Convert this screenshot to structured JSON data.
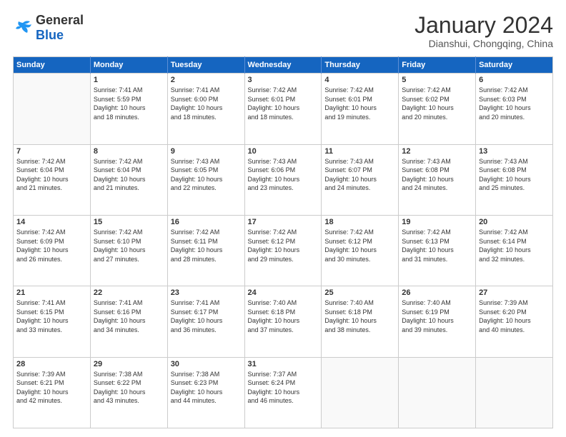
{
  "header": {
    "logo_line1": "General",
    "logo_line2": "Blue",
    "title": "January 2024",
    "subtitle": "Dianshui, Chongqing, China"
  },
  "calendar": {
    "days_of_week": [
      "Sunday",
      "Monday",
      "Tuesday",
      "Wednesday",
      "Thursday",
      "Friday",
      "Saturday"
    ],
    "weeks": [
      [
        {
          "day": "",
          "info": ""
        },
        {
          "day": "1",
          "info": "Sunrise: 7:41 AM\nSunset: 5:59 PM\nDaylight: 10 hours\nand 18 minutes."
        },
        {
          "day": "2",
          "info": "Sunrise: 7:41 AM\nSunset: 6:00 PM\nDaylight: 10 hours\nand 18 minutes."
        },
        {
          "day": "3",
          "info": "Sunrise: 7:42 AM\nSunset: 6:01 PM\nDaylight: 10 hours\nand 18 minutes."
        },
        {
          "day": "4",
          "info": "Sunrise: 7:42 AM\nSunset: 6:01 PM\nDaylight: 10 hours\nand 19 minutes."
        },
        {
          "day": "5",
          "info": "Sunrise: 7:42 AM\nSunset: 6:02 PM\nDaylight: 10 hours\nand 20 minutes."
        },
        {
          "day": "6",
          "info": "Sunrise: 7:42 AM\nSunset: 6:03 PM\nDaylight: 10 hours\nand 20 minutes."
        }
      ],
      [
        {
          "day": "7",
          "info": "Sunrise: 7:42 AM\nSunset: 6:04 PM\nDaylight: 10 hours\nand 21 minutes."
        },
        {
          "day": "8",
          "info": "Sunrise: 7:42 AM\nSunset: 6:04 PM\nDaylight: 10 hours\nand 21 minutes."
        },
        {
          "day": "9",
          "info": "Sunrise: 7:43 AM\nSunset: 6:05 PM\nDaylight: 10 hours\nand 22 minutes."
        },
        {
          "day": "10",
          "info": "Sunrise: 7:43 AM\nSunset: 6:06 PM\nDaylight: 10 hours\nand 23 minutes."
        },
        {
          "day": "11",
          "info": "Sunrise: 7:43 AM\nSunset: 6:07 PM\nDaylight: 10 hours\nand 24 minutes."
        },
        {
          "day": "12",
          "info": "Sunrise: 7:43 AM\nSunset: 6:08 PM\nDaylight: 10 hours\nand 24 minutes."
        },
        {
          "day": "13",
          "info": "Sunrise: 7:43 AM\nSunset: 6:08 PM\nDaylight: 10 hours\nand 25 minutes."
        }
      ],
      [
        {
          "day": "14",
          "info": "Sunrise: 7:42 AM\nSunset: 6:09 PM\nDaylight: 10 hours\nand 26 minutes."
        },
        {
          "day": "15",
          "info": "Sunrise: 7:42 AM\nSunset: 6:10 PM\nDaylight: 10 hours\nand 27 minutes."
        },
        {
          "day": "16",
          "info": "Sunrise: 7:42 AM\nSunset: 6:11 PM\nDaylight: 10 hours\nand 28 minutes."
        },
        {
          "day": "17",
          "info": "Sunrise: 7:42 AM\nSunset: 6:12 PM\nDaylight: 10 hours\nand 29 minutes."
        },
        {
          "day": "18",
          "info": "Sunrise: 7:42 AM\nSunset: 6:12 PM\nDaylight: 10 hours\nand 30 minutes."
        },
        {
          "day": "19",
          "info": "Sunrise: 7:42 AM\nSunset: 6:13 PM\nDaylight: 10 hours\nand 31 minutes."
        },
        {
          "day": "20",
          "info": "Sunrise: 7:42 AM\nSunset: 6:14 PM\nDaylight: 10 hours\nand 32 minutes."
        }
      ],
      [
        {
          "day": "21",
          "info": "Sunrise: 7:41 AM\nSunset: 6:15 PM\nDaylight: 10 hours\nand 33 minutes."
        },
        {
          "day": "22",
          "info": "Sunrise: 7:41 AM\nSunset: 6:16 PM\nDaylight: 10 hours\nand 34 minutes."
        },
        {
          "day": "23",
          "info": "Sunrise: 7:41 AM\nSunset: 6:17 PM\nDaylight: 10 hours\nand 36 minutes."
        },
        {
          "day": "24",
          "info": "Sunrise: 7:40 AM\nSunset: 6:18 PM\nDaylight: 10 hours\nand 37 minutes."
        },
        {
          "day": "25",
          "info": "Sunrise: 7:40 AM\nSunset: 6:18 PM\nDaylight: 10 hours\nand 38 minutes."
        },
        {
          "day": "26",
          "info": "Sunrise: 7:40 AM\nSunset: 6:19 PM\nDaylight: 10 hours\nand 39 minutes."
        },
        {
          "day": "27",
          "info": "Sunrise: 7:39 AM\nSunset: 6:20 PM\nDaylight: 10 hours\nand 40 minutes."
        }
      ],
      [
        {
          "day": "28",
          "info": "Sunrise: 7:39 AM\nSunset: 6:21 PM\nDaylight: 10 hours\nand 42 minutes."
        },
        {
          "day": "29",
          "info": "Sunrise: 7:38 AM\nSunset: 6:22 PM\nDaylight: 10 hours\nand 43 minutes."
        },
        {
          "day": "30",
          "info": "Sunrise: 7:38 AM\nSunset: 6:23 PM\nDaylight: 10 hours\nand 44 minutes."
        },
        {
          "day": "31",
          "info": "Sunrise: 7:37 AM\nSunset: 6:24 PM\nDaylight: 10 hours\nand 46 minutes."
        },
        {
          "day": "",
          "info": ""
        },
        {
          "day": "",
          "info": ""
        },
        {
          "day": "",
          "info": ""
        }
      ]
    ]
  }
}
